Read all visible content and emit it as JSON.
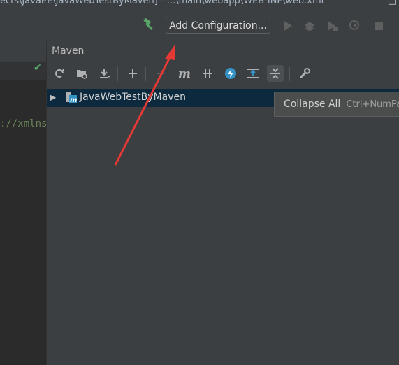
{
  "titlebar": {
    "text": "ects\\JavaEE\\JavaWebTestByMaven] - ...\\main\\webapp\\WEB-INF\\web.xml",
    "minimize": "—",
    "maximize": "□"
  },
  "toolbar": {
    "add_configuration_label": "Add Configuration..."
  },
  "editor": {
    "code_fragment": "://xmlns"
  },
  "maven": {
    "title": "Maven",
    "toolbar_icons": [
      "reload-icon",
      "generate-sources-icon",
      "download-icon",
      "add-icon",
      "run-icon",
      "maven-goal-icon",
      "toggle-offline-icon",
      "skip-tests-icon",
      "show-dependencies-icon",
      "collapse-all-icon",
      "settings-icon"
    ],
    "tree": [
      {
        "label": "JavaWebTestByMaven",
        "expanded": false
      }
    ]
  },
  "tooltip": {
    "label": "Collapse All",
    "shortcut": "Ctrl+NumPa"
  },
  "colors": {
    "accent_green": "#59a869",
    "selection": "#0d293e",
    "annotation_arrow": "#e53935"
  }
}
